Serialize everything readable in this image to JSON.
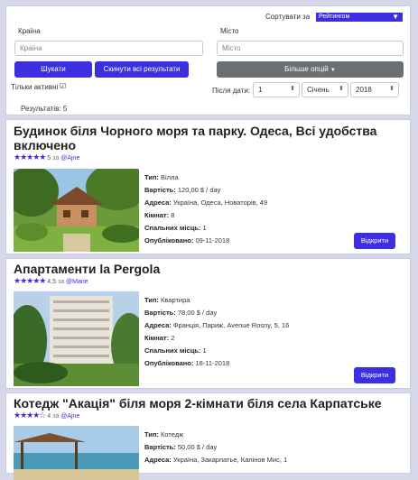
{
  "filters": {
    "sort_label": "Сортувати за",
    "sort_value": "Рейтингом",
    "country_label": "Країна",
    "country_placeholder": "Країна",
    "city_label": "Місто",
    "city_placeholder": "Місто",
    "search_button": "Шукати",
    "reset_button": "Скинути всі результати",
    "more_options_button": "Більше опцій",
    "active_only_label": "Тільки активні",
    "active_only_checked": true,
    "after_date_label": "Після дати:",
    "day_value": "1",
    "month_value": "Січень",
    "year_value": "2018",
    "results_label": "Результатів: 5"
  },
  "labels": {
    "type": "Тип:",
    "price": "Вартість:",
    "address": "Адреса:",
    "rooms": "Кімнат:",
    "beds": "Спальних місць:",
    "published": "Опубліковано:",
    "open_button": "Відкрити",
    "by": "за"
  },
  "listings": [
    {
      "title": "Будинок біля Чорного моря та парку. Одеса, Всі удобства включено",
      "rating": "5",
      "stars": 5,
      "user": "@Ajne",
      "type": "Вілла",
      "price": "120,00 $ / day",
      "address": "Україна, Одеса, Новаторів, 49",
      "rooms": "8",
      "beds": "1",
      "published": "09-11-2018"
    },
    {
      "title": "Апартаменти la Pergola",
      "rating": "4,5",
      "stars": 4.5,
      "user": "@Marie",
      "type": "Квартира",
      "price": "78,00 $ / day",
      "address": "Франція, Париж, Avenue Rosny, 5, 16",
      "rooms": "2",
      "beds": "1",
      "published": "18-11-2018"
    },
    {
      "title": "Котедж \"Акація\" біля моря 2-кімнати біля села Карпатське",
      "rating": "4",
      "stars": 4,
      "user": "@Ajne",
      "type": "Котедж",
      "price": "50,00 $ / day",
      "address": "Україна, Закарпатье, Калінов Мис, 1"
    }
  ],
  "colors": {
    "accent": "#3b2fe0",
    "page_bg": "#d6d8ea",
    "secondary_button": "#6b6f74"
  }
}
